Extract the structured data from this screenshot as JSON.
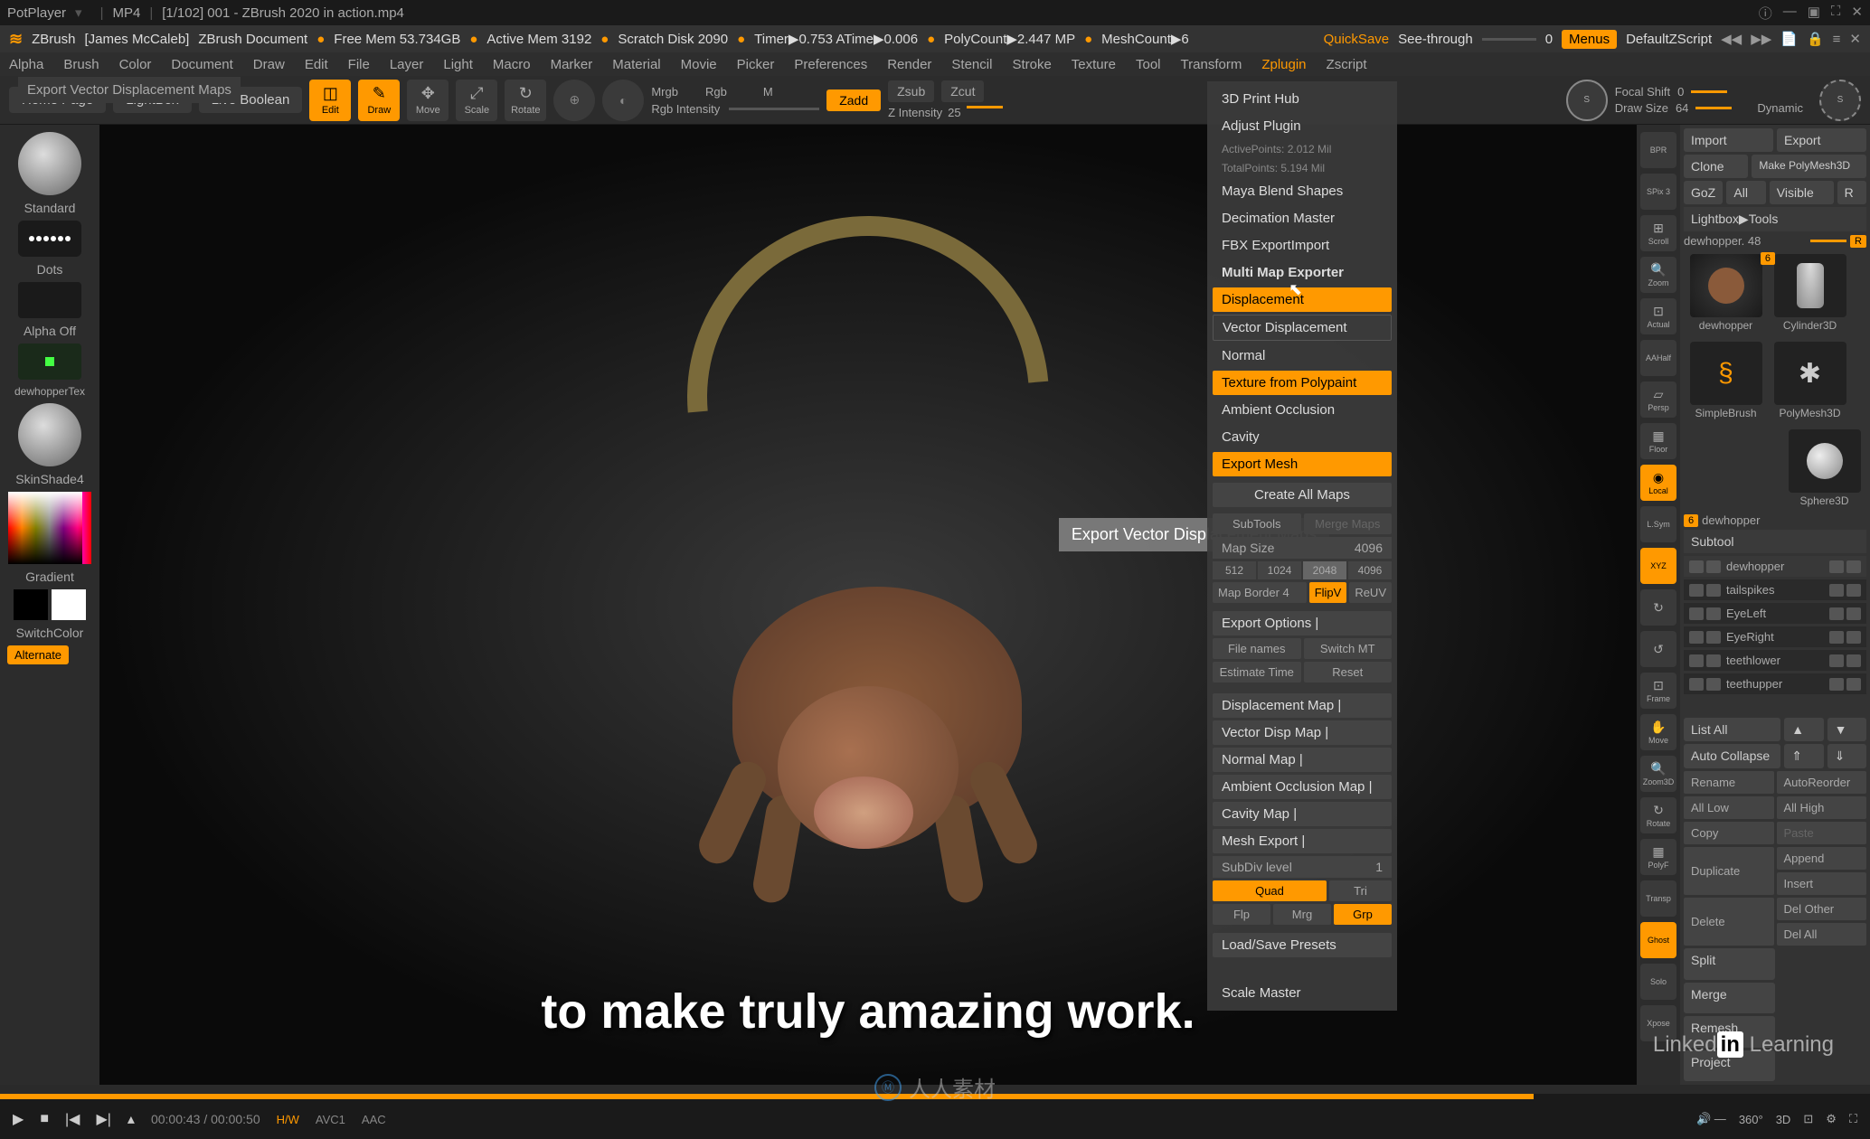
{
  "titlebar": {
    "app": "PotPlayer",
    "format": "MP4",
    "file": "[1/102] 001 - ZBrush 2020 in action.mp4"
  },
  "infobar": {
    "zbrush": "ZBrush",
    "artist": "[James McCaleb]",
    "doc": "ZBrush Document",
    "freemem": "Free Mem 53.734GB",
    "activemem": "Active Mem 3192",
    "scratch": "Scratch Disk 2090",
    "timer": "Timer▶0.753 ATime▶0.006",
    "polycount": "PolyCount▶2.447 MP",
    "meshcount": "MeshCount▶6",
    "quicksave": "QuickSave",
    "seethrough": "See-through",
    "seethroughval": "0",
    "menus": "Menus",
    "defaultz": "DefaultZScript"
  },
  "menubar": [
    "Alpha",
    "Brush",
    "Color",
    "Document",
    "Draw",
    "Edit",
    "File",
    "Layer",
    "Light",
    "Macro",
    "Marker",
    "Material",
    "Movie",
    "Picker",
    "Preferences",
    "Render",
    "Stencil",
    "Stroke",
    "Texture",
    "Tool",
    "Transform",
    "Zplugin",
    "Zscript"
  ],
  "subheader": "Export Vector Displacement Maps",
  "toolrow": {
    "home": "Home Page",
    "lightbox": "LightBox",
    "liveboolean": "Live Boolean",
    "edit": "Edit",
    "draw": "Draw",
    "move": "Move",
    "scale": "Scale",
    "rotate": "Rotate",
    "mrgb": "Mrgb",
    "rgb": "Rgb",
    "m": "M",
    "rgbint": "Rgb Intensity",
    "zadd": "Zadd",
    "zsub": "Zsub",
    "zcut": "Zcut",
    "zint": "Z Intensity",
    "zintval": "25",
    "focalshift": "Focal Shift",
    "focalval": "0",
    "drawsize": "Draw Size",
    "drawsizeval": "64",
    "dynamic": "Dynamic"
  },
  "leftbar": {
    "standard": "Standard",
    "dots": "Dots",
    "alphaoff": "Alpha Off",
    "dewhopper": "dewhopperTex",
    "skinshade": "SkinShade4",
    "gradient": "Gradient",
    "switchcolor": "SwitchColor",
    "alternate": "Alternate"
  },
  "viewport": {
    "tooltip": "Export Vector Displacement Maps",
    "subtitle": "to make truly amazing work."
  },
  "dropdown": {
    "threedprint": "3D Print Hub",
    "adjustplugin": "Adjust Plugin",
    "activepts": "ActivePoints: 2.012 Mil",
    "totalpts": "TotalPoints: 5.194 Mil",
    "mayablend": "Maya Blend Shapes",
    "decimation": "Decimation Master",
    "fbx": "FBX ExportImport",
    "mme": "Multi Map Exporter",
    "displacement": "Displacement",
    "vectordisp": "Vector Displacement",
    "normal": "Normal",
    "texturepoly": "Texture from Polypaint",
    "ao": "Ambient Occlusion",
    "cavity": "Cavity",
    "exportmesh": "Export Mesh",
    "createall": "Create All Maps",
    "subtools": "SubTools",
    "mergemaps": "Merge Maps",
    "mapsize": "Map Size",
    "mapsizeval": "4096",
    "sizes": [
      "512",
      "1024",
      "2048",
      "4096"
    ],
    "mapborder": "Map Border",
    "mapborderval": "4",
    "flipv": "FlipV",
    "reuv": "ReUV",
    "exportoptions": "Export Options |",
    "filenames": "File names",
    "switchmt": "Switch MT",
    "esttime": "Estimate Time",
    "reset": "Reset",
    "dispmap": "Displacement Map |",
    "vdispmap": "Vector Disp Map |",
    "normalmap": "Normal Map |",
    "aomap": "Ambient Occlusion Map |",
    "cavitymap": "Cavity Map |",
    "meshexport": "Mesh Export |",
    "subdiv": "SubDiv level",
    "subdivval": "1",
    "quad": "Quad",
    "tri": "Tri",
    "flp": "Flp",
    "mrg": "Mrg",
    "grp": "Grp",
    "loadsave": "Load/Save Presets",
    "scalemaster": "Scale Master"
  },
  "sidestrip": [
    "BPR",
    "SPix 3",
    "Scroll",
    "Zoom",
    "Actual",
    "AAHalf",
    "Persp",
    "Floor",
    "Local",
    "L.Sym",
    "XYZ",
    "",
    "",
    "Frame",
    "Move",
    "Zoom3D",
    "Rotate",
    "PolyF",
    "Transp",
    "Ghost",
    "Solo",
    "Xpose"
  ],
  "sidestrip_active": [
    9,
    11,
    20
  ],
  "rightpanel": {
    "import": "Import",
    "export": "Export",
    "clone": "Clone",
    "makepoly": "Make PolyMesh3D",
    "goz": "GoZ",
    "all": "All",
    "visible": "Visible",
    "r": "R",
    "lightboxtools": "Lightbox▶Tools",
    "dewhop": "dewhopper. 48",
    "badge6": "6",
    "thumbs": [
      {
        "lbl": "dewhopper"
      },
      {
        "lbl": "Cylinder3D"
      },
      {
        "lbl": "SimpleBrush"
      },
      {
        "lbl": "PolyMesh3D"
      },
      {
        "lbl": "Sphere3D"
      }
    ],
    "dewhop2": "dewhopper",
    "subtool": "Subtool",
    "subtools": [
      "dewhopper",
      "tailspikes",
      "EyeLeft",
      "EyeRight",
      "teethlower",
      "teethupper"
    ],
    "listall": "List All",
    "autocollapse": "Auto Collapse",
    "rename": "Rename",
    "autoreorder": "AutoReorder",
    "alllow": "All Low",
    "allhigh": "All High",
    "copy": "Copy",
    "paste": "Paste",
    "duplicate": "Duplicate",
    "append": "Append",
    "insert": "Insert",
    "delete": "Delete",
    "delother": "Del Other",
    "delall": "Del All",
    "split": "Split",
    "merge": "Merge",
    "remesh": "Remesh",
    "project": "Project"
  },
  "player": {
    "curtime": "00:00:43",
    "tottime": "00:00:50",
    "hw": "H/W",
    "avc": "AVC1",
    "aac": "AAC",
    "threesixty": "360°",
    "threed": "3D"
  },
  "watermark": {
    "center": "人人素材",
    "right": "Linked",
    "right2": "in",
    "right3": " Learning"
  }
}
